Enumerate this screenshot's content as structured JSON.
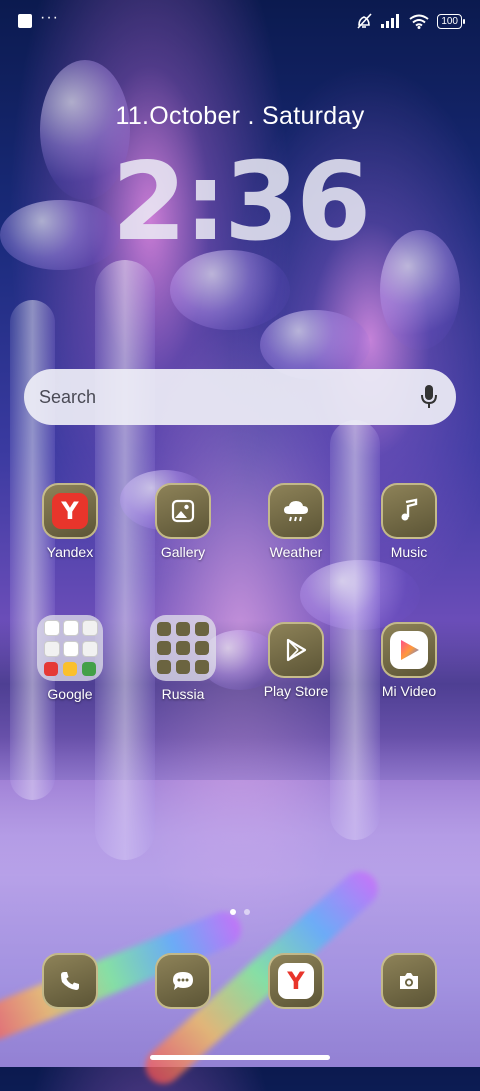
{
  "status_bar": {
    "overflow_indicator": "···",
    "battery_level": "100"
  },
  "lock_area": {
    "date": "11.October . Saturday",
    "time": "2:36"
  },
  "search": {
    "placeholder": "Search"
  },
  "apps_row1": [
    {
      "label": "Yandex",
      "icon": "yandex-icon"
    },
    {
      "label": "Gallery",
      "icon": "gallery-icon"
    },
    {
      "label": "Weather",
      "icon": "weather-icon"
    },
    {
      "label": "Music",
      "icon": "music-icon"
    }
  ],
  "apps_row2": [
    {
      "label": "Google",
      "icon": "folder-icon"
    },
    {
      "label": "Russia",
      "icon": "folder-icon"
    },
    {
      "label": "Play Store",
      "icon": "play-store-icon"
    },
    {
      "label": "Mi Video",
      "icon": "mi-video-icon"
    }
  ],
  "dock": [
    {
      "icon": "phone-icon"
    },
    {
      "icon": "messages-icon"
    },
    {
      "icon": "yandex-browser-icon"
    },
    {
      "icon": "camera-icon"
    }
  ],
  "page_indicator": {
    "pages": 2,
    "current": 1
  },
  "colors": {
    "tile_gold": "#8d8258",
    "yandex_red": "#e8352b",
    "accent_text": "#ffffff"
  }
}
